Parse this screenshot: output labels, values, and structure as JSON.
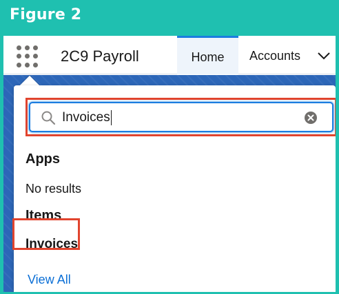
{
  "figure_label": "Figure 2",
  "header": {
    "app_name": "2C9 Payroll",
    "tabs": [
      {
        "label": "Home",
        "active": true
      },
      {
        "label": "Accounts"
      }
    ]
  },
  "search": {
    "value": "Invoices"
  },
  "results": {
    "apps_heading": "Apps",
    "apps_empty": "No results",
    "items_heading": "Items",
    "items": [
      {
        "label": "Invoices"
      }
    ],
    "view_all": "View All"
  },
  "colors": {
    "background": "#1fc0b0",
    "accent": "#1b7de0",
    "highlight": "#e1442e",
    "link": "#0b6fd6"
  },
  "icons": [
    "app-launcher-icon",
    "chevron-down-icon",
    "search-icon",
    "clear-icon"
  ]
}
